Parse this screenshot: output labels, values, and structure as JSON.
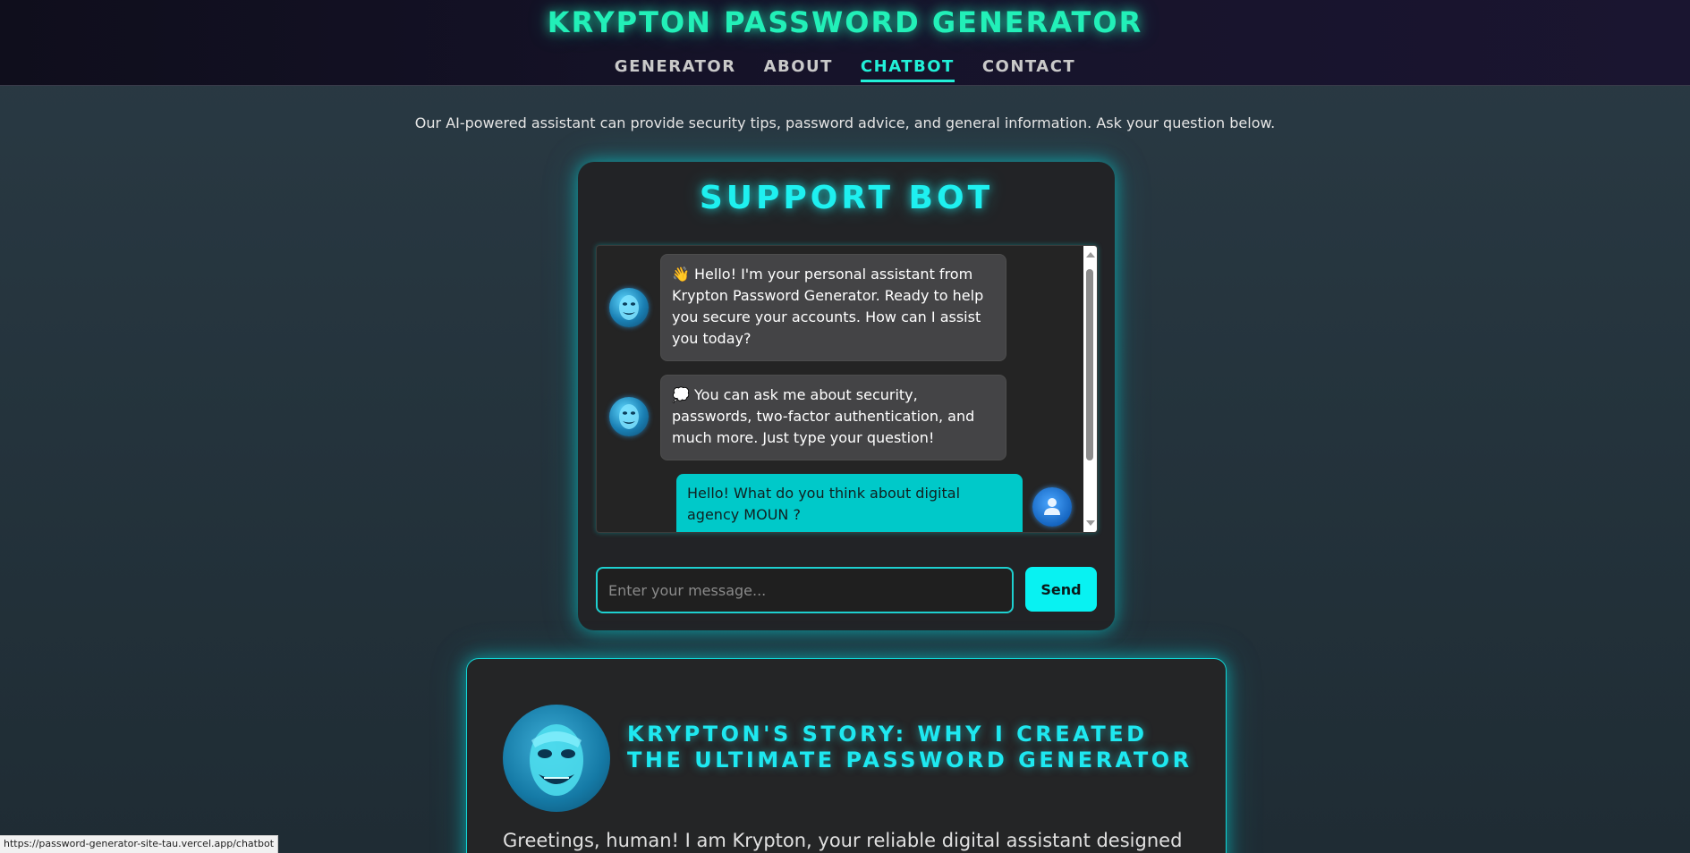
{
  "header": {
    "title": "KRYPTON PASSWORD GENERATOR",
    "nav": [
      {
        "label": "GENERATOR",
        "active": false
      },
      {
        "label": "ABOUT",
        "active": false
      },
      {
        "label": "CHATBOT",
        "active": true
      },
      {
        "label": "CONTACT",
        "active": false
      }
    ]
  },
  "intro": "Our AI-powered assistant can provide security tips, password advice, and general information. Ask your question below.",
  "chatbot": {
    "title": "SUPPORT BOT",
    "messages": [
      {
        "from": "bot",
        "icon": "waving-hand-icon",
        "text": "👋 Hello! I'm your personal assistant from Krypton Password Generator. Ready to help you secure your accounts. How can I assist you today?"
      },
      {
        "from": "bot",
        "icon": "speech-bubble-icon",
        "text": "💭 You can ask me about security, passwords, two-factor authentication, and much more. Just type your question!"
      },
      {
        "from": "user",
        "text": "Hello! What do you think about digital agency MOUN ?"
      }
    ],
    "input_placeholder": "Enter your message...",
    "send_label": "Send"
  },
  "story": {
    "title": "KRYPTON'S STORY: WHY I CREATED THE ULTIMATE PASSWORD GENERATOR",
    "text": "Greetings, human! I am Krypton, your reliable digital assistant designed"
  },
  "status_bar": {
    "url": "https://password-generator-site-tau.vercel.app/chatbot"
  },
  "colors": {
    "accent": "#1ef0f0",
    "title_green": "#22f0b8",
    "user_bubble": "#00c9c9",
    "bot_bubble": "#444446"
  }
}
